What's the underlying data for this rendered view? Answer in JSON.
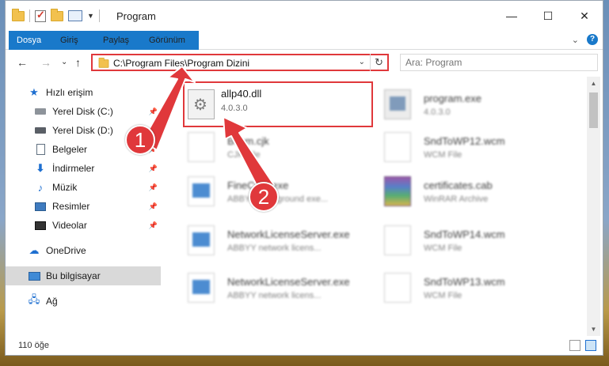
{
  "window": {
    "title": "Program",
    "controls": {
      "minimize": "—",
      "maximize": "☐",
      "close": "✕"
    }
  },
  "ribbon": {
    "tabs": [
      "Dosya",
      "Giriş",
      "Paylaş",
      "Görünüm"
    ],
    "help": "?"
  },
  "nav": {
    "back": "←",
    "forward": "→",
    "recent": "⌄",
    "up": "↑",
    "address": "C:\\Program Files\\Program Dizini",
    "search_placeholder": "Ara: Program"
  },
  "sidebar": {
    "items": [
      {
        "label": "Hızlı erişim",
        "icon": "star-icon"
      },
      {
        "label": "Yerel Disk (C:)",
        "icon": "drive-icon",
        "pinned": true
      },
      {
        "label": "Yerel Disk (D:)",
        "icon": "drive-icon",
        "pinned": true
      },
      {
        "label": "Belgeler",
        "icon": "document-icon",
        "pinned": true
      },
      {
        "label": "İndirmeler",
        "icon": "download-icon",
        "pinned": true
      },
      {
        "label": "Müzik",
        "icon": "music-icon",
        "pinned": true
      },
      {
        "label": "Resimler",
        "icon": "pictures-icon",
        "pinned": true
      },
      {
        "label": "Videolar",
        "icon": "video-icon",
        "pinned": true
      },
      {
        "label": "OneDrive",
        "icon": "cloud-icon"
      },
      {
        "label": "Bu bilgisayar",
        "icon": "computer-icon",
        "selected": true
      },
      {
        "label": "Ağ",
        "icon": "network-icon"
      }
    ]
  },
  "files": [
    {
      "name": "allp40.dll",
      "sub": "4.0.3.0",
      "icon": "dll"
    },
    {
      "name": "program.exe",
      "sub": "4.0.3.0",
      "icon": "exe"
    },
    {
      "name": "Bcom.cjk",
      "sub": "CJK File",
      "icon": "blank"
    },
    {
      "name": "SndToWP12.wcm",
      "sub": "WCM File",
      "icon": "blank"
    },
    {
      "name": "FineCmd.exe",
      "sub": "ABBYY background exe...",
      "icon": "app"
    },
    {
      "name": "certificates.cab",
      "sub": "WinRAR Archive",
      "icon": "rar"
    },
    {
      "name": "NetworkLicenseServer.exe",
      "sub": "ABBYY network licens...",
      "icon": "app"
    },
    {
      "name": "SndToWP14.wcm",
      "sub": "WCM File",
      "icon": "blank"
    },
    {
      "name": "NetworkLicenseServer.exe",
      "sub": "ABBYY network licens...",
      "icon": "app"
    },
    {
      "name": "SndToWP13.wcm",
      "sub": "WCM File",
      "icon": "blank"
    }
  ],
  "status": {
    "count": "110 öğe"
  },
  "annotations": {
    "step1": "1",
    "step2": "2",
    "color": "#e0383b"
  }
}
